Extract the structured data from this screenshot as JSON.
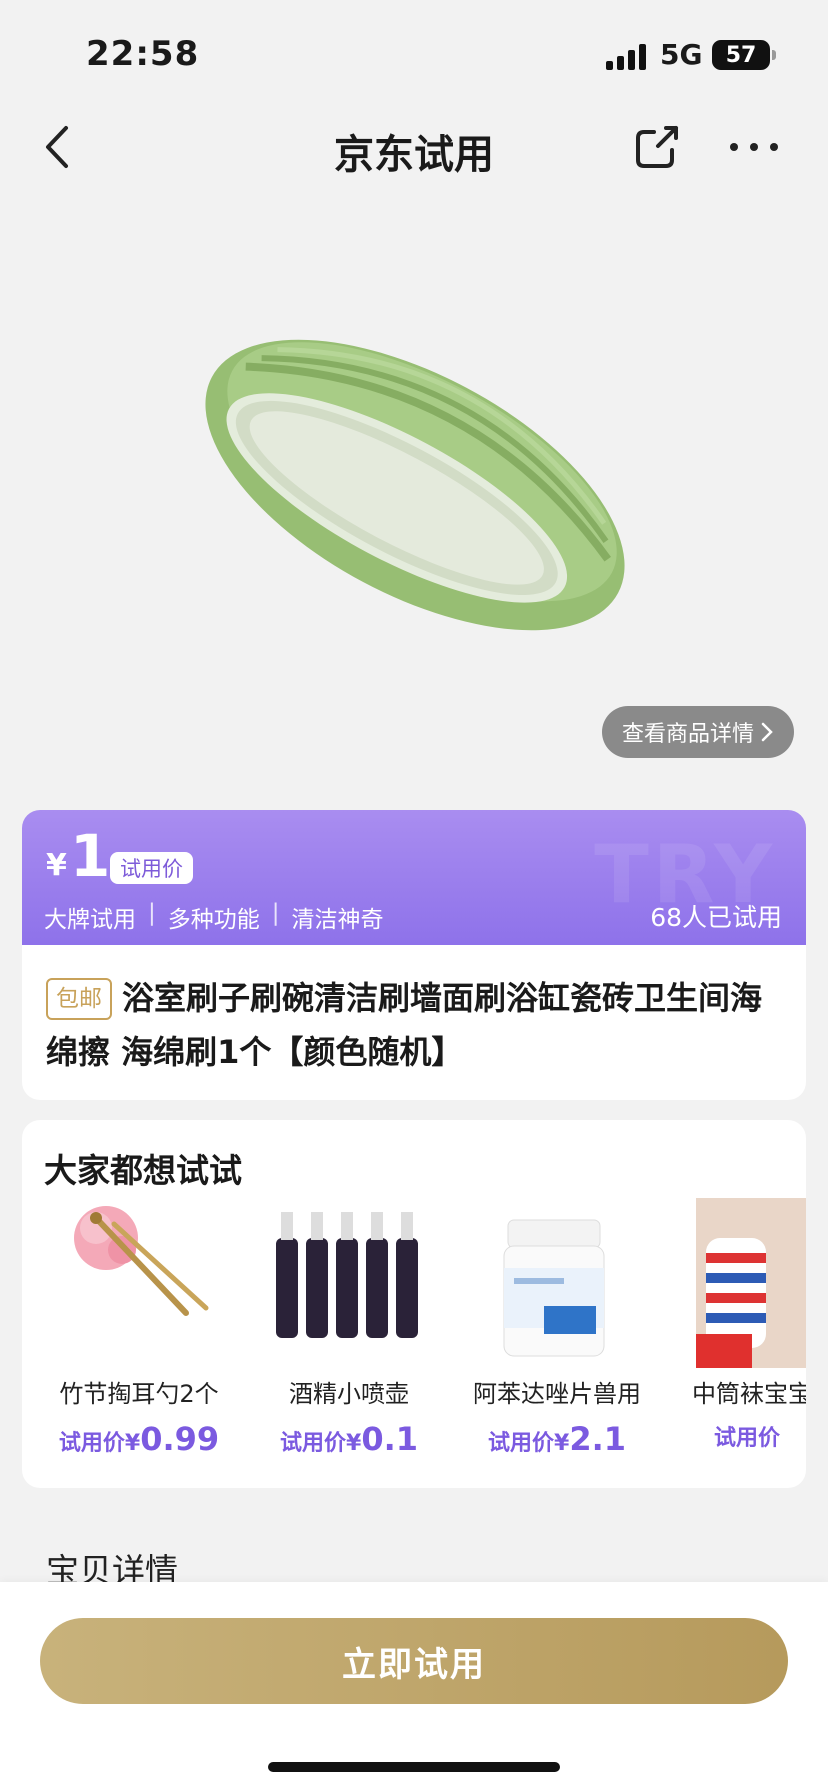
{
  "status": {
    "time": "22:58",
    "network": "5G",
    "battery": "57"
  },
  "nav": {
    "title": "京东试用"
  },
  "product": {
    "detail_link": "查看商品详情",
    "price_symbol": "¥",
    "price": "1",
    "price_tag": "试用价",
    "features": [
      "大牌试用",
      "多种功能",
      "清洁神奇"
    ],
    "tried_count": "68人已试用",
    "shipping_badge": "包邮",
    "title": "浴室刷子刷碗清洁刷墙面刷浴缸瓷砖卫生间海绵擦 海绵刷1个【颜色随机】"
  },
  "recommend": {
    "title": "大家都想试试",
    "price_label": "试用价",
    "currency": "¥",
    "items": [
      {
        "name": "竹节掏耳勺2个",
        "price": "0.99"
      },
      {
        "name": "酒精小喷壶",
        "price": "0.1"
      },
      {
        "name": "阿苯达唑片兽用",
        "price": "2.1"
      },
      {
        "name": "中筒袜宝宝",
        "price": ""
      }
    ]
  },
  "details": {
    "title": "宝贝详情"
  },
  "bottom": {
    "button": "立即试用"
  },
  "colors": {
    "accent": "#8e72ea",
    "gold": "#c8a25a",
    "button": "#bfa56a"
  }
}
